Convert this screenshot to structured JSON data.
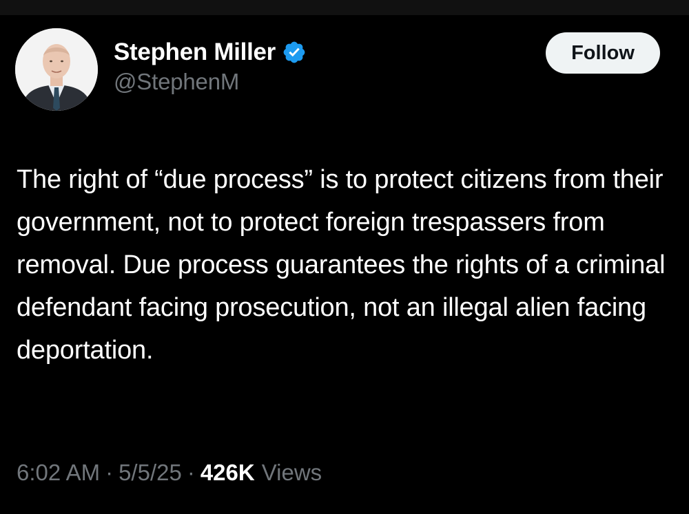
{
  "author": {
    "display_name": "Stephen Miller",
    "handle": "@StephenM",
    "verified_icon": "verified-badge-icon",
    "avatar_icon": "profile-photo"
  },
  "follow_button": {
    "label": "Follow"
  },
  "tweet": {
    "text": "The right of “due process” is to protect citizens from their government, not to protect foreign trespassers from removal. Due process guarantees the rights of a criminal defendant facing prosecution, not an illegal alien facing deportation."
  },
  "meta": {
    "time": "6:02 AM",
    "separator": "·",
    "date": "5/5/25",
    "views_count": "426K",
    "views_label": "Views"
  },
  "colors": {
    "background": "#000000",
    "text_primary": "#ffffff",
    "text_secondary": "#71767b",
    "verified_blue": "#1d9bf0",
    "follow_bg": "#eff3f4",
    "follow_text": "#0f1419"
  }
}
